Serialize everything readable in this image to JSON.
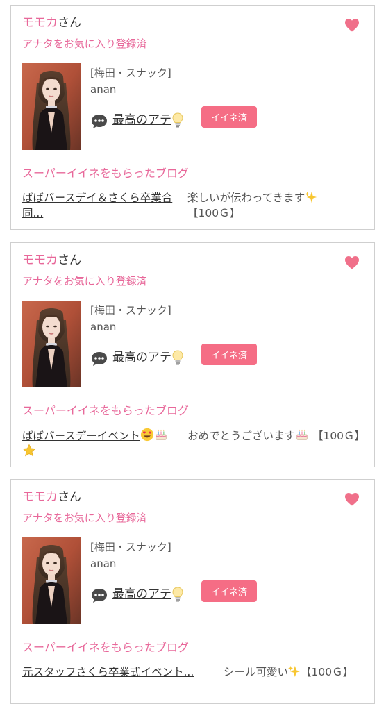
{
  "cards": [
    {
      "name": "モモカ",
      "name_suffix": "さん",
      "fav_label": "アナタをお気に入り登録済",
      "shop": "[梅田・スナック]",
      "cast": "anan",
      "comment": "最高のアテ",
      "iine_label": "イイネ済",
      "blog_heading": "スーパーイイネをもらったブログ",
      "blog_title": "ばばバースデイ＆さくら卒業合同...",
      "blog_comment": "楽しいが伝わってきます",
      "blog_reward": "【100Ｇ】"
    },
    {
      "name": "モモカ",
      "name_suffix": "さん",
      "fav_label": "アナタをお気に入り登録済",
      "shop": "[梅田・スナック]",
      "cast": "anan",
      "comment": "最高のアテ",
      "iine_label": "イイネ済",
      "blog_heading": "スーパーイイネをもらったブログ",
      "blog_title": "ばばバースデーイベント",
      "blog_comment": "おめでとうございます",
      "blog_reward": "【100Ｇ】"
    },
    {
      "name": "モモカ",
      "name_suffix": "さん",
      "fav_label": "アナタをお気に入り登録済",
      "shop": "[梅田・スナック]",
      "cast": "anan",
      "comment": "最高のアテ",
      "iine_label": "イイネ済",
      "blog_heading": "スーパーイイネをもらったブログ",
      "blog_title": "元スタッフさくら卒業式イベント...",
      "blog_comment": "シール可愛い",
      "blog_reward": "【100Ｇ】"
    }
  ],
  "colors": {
    "accent_pink": "#e8689a",
    "button_pink": "#f56d85",
    "heart": "#f0708a"
  },
  "icons": [
    "heart-icon",
    "speech-bubble-icon",
    "lightbulb-icon",
    "sparkles-icon",
    "heart-eyes-emoji",
    "cake-icon",
    "star-icon"
  ]
}
